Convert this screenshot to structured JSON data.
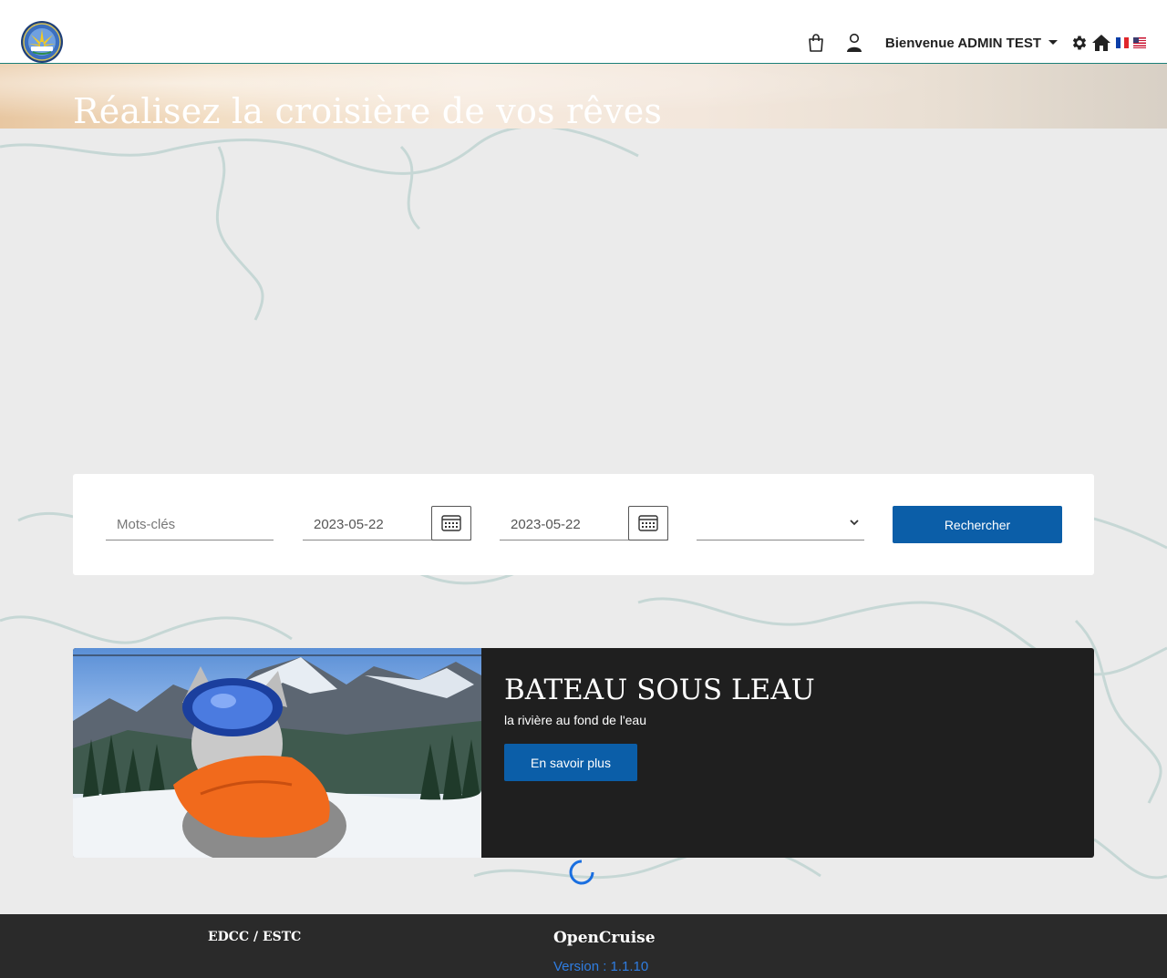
{
  "header": {
    "welcome_text": "Bienvenue ADMIN TEST",
    "languages": [
      "FR",
      "EN"
    ]
  },
  "hero": {
    "title": "Réalisez la croisière de vos rêves"
  },
  "search": {
    "keywords_placeholder": "Mots-clés",
    "start_date": "2023-05-22",
    "end_date": "2023-05-22",
    "select_value": "",
    "button_label": "Rechercher"
  },
  "featured": {
    "title": "BATEAU SOUS LEAU",
    "subtitle": "la rivière au fond de l'eau",
    "button_label": "En savoir plus"
  },
  "footer": {
    "org": "EDCC / ESTC",
    "app_name": "OpenCruise",
    "version": "Version : 1.1.10"
  },
  "colors": {
    "primary_button": "#0b5ea8",
    "card_bg": "#1f1f1f",
    "footer_bg": "#2a2a2a",
    "version_link": "#2f7de1",
    "header_border": "#1a7f78"
  },
  "icons": [
    "logo-emblem",
    "shopping-bag-icon",
    "user-icon",
    "gear-icon",
    "home-icon",
    "flag-fr-icon",
    "flag-us-icon",
    "calendar-icon",
    "chevron-down-icon",
    "loading-spinner"
  ]
}
